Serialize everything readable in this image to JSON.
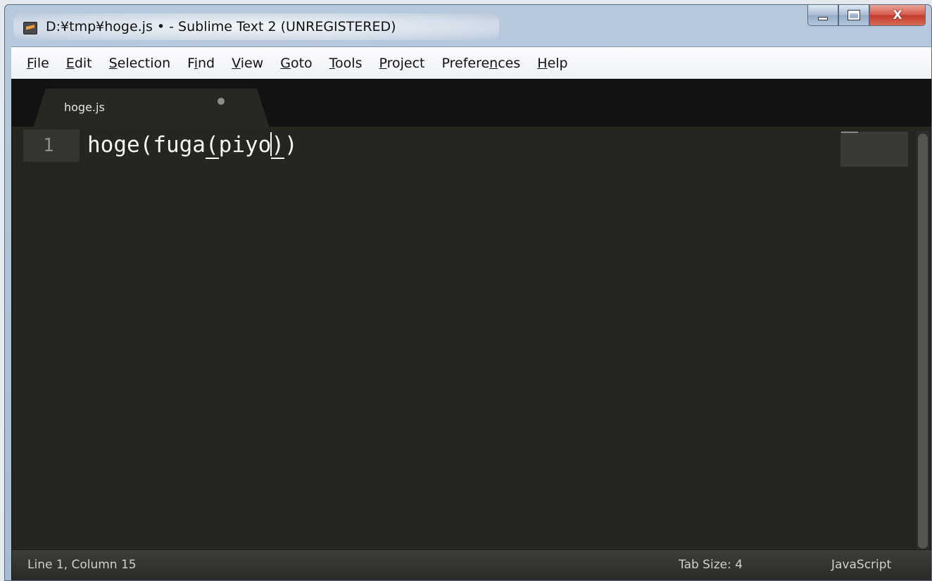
{
  "window": {
    "title": "D:¥tmp¥hoge.js • - Sublime Text 2 (UNREGISTERED)",
    "icon": "sublime-text-icon",
    "caption_buttons": {
      "minimize_icon": "minimize-icon",
      "maximize_icon": "maximize-icon",
      "close_icon": "close-icon",
      "close_glyph": "X"
    }
  },
  "menu": {
    "items": [
      {
        "pre": "",
        "key": "F",
        "post": "ile"
      },
      {
        "pre": "",
        "key": "E",
        "post": "dit"
      },
      {
        "pre": "",
        "key": "S",
        "post": "election"
      },
      {
        "pre": "F",
        "key": "i",
        "post": "nd"
      },
      {
        "pre": "",
        "key": "V",
        "post": "iew"
      },
      {
        "pre": "",
        "key": "G",
        "post": "oto"
      },
      {
        "pre": "",
        "key": "T",
        "post": "ools"
      },
      {
        "pre": "",
        "key": "P",
        "post": "roject"
      },
      {
        "pre": "Prefere",
        "key": "n",
        "post": "ces"
      },
      {
        "pre": "",
        "key": "H",
        "post": "elp"
      }
    ]
  },
  "tabs": [
    {
      "label": "hoge.js",
      "dirty": true,
      "active": true
    }
  ],
  "editor": {
    "line_number": "1",
    "code": {
      "part1": "hoge(fuga",
      "bracket_open": "(",
      "part2": "piyo",
      "bracket_close": ")",
      "part3": ")"
    },
    "colors": {
      "background": "#272822",
      "foreground": "#f8f8f2",
      "gutter_text": "#8f908a"
    }
  },
  "status": {
    "position": "Line 1, Column 15",
    "tab_size": "Tab Size: 4",
    "syntax": "JavaScript"
  }
}
